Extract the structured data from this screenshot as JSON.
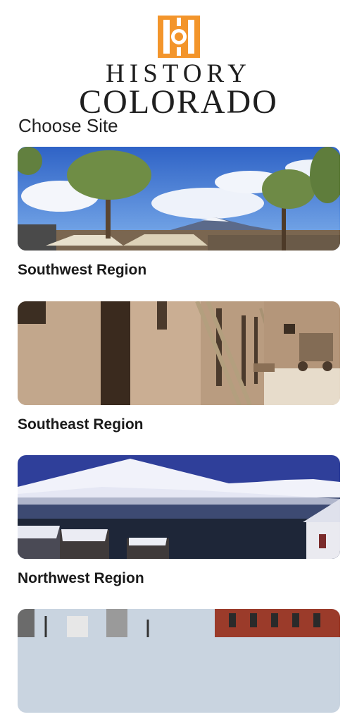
{
  "brand": {
    "line1": "HISTORY",
    "line2": "COLORADO",
    "accent": "#f3952b"
  },
  "heading": "Choose Site",
  "sites": [
    {
      "label": "Southwest Region",
      "image": "adobe-fort-trees-mountains"
    },
    {
      "label": "Southeast Region",
      "image": "adobe-walls-ladders"
    },
    {
      "label": "Northwest Region",
      "image": "snowy-mountain-town"
    },
    {
      "label": "",
      "image": "city-street-buildings"
    }
  ]
}
